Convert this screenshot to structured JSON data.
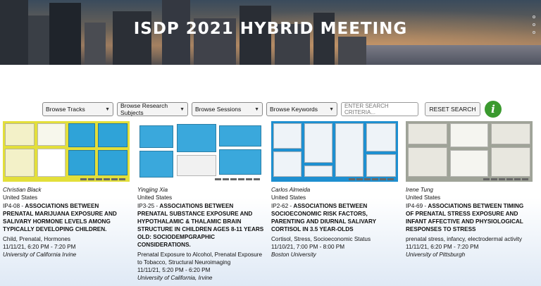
{
  "banner": {
    "title": "ISDP 2021 HYBRID MEETING"
  },
  "filters": {
    "tracks": "Browse Tracks",
    "subjects": "Browse Research Subjects",
    "sessions": "Browse Sessions",
    "keywords": "Browse Keywords",
    "search_placeholder": "ENTER SEARCH CRITERIA...",
    "reset_label": "RESET SEARCH",
    "info_glyph": "i"
  },
  "colors": {
    "info": "#3b9a2f",
    "yellow_poster": "#e3df3a",
    "blue_poster": "#2fa3d8"
  },
  "cards": [
    {
      "author": "Christian Black",
      "country": "United States",
      "code": "IP4-08",
      "title": "ASSOCIATIONS BETWEEN PRENATAL MARIJUANA EXPOSURE AND SALIVARY HORMONE LEVELS AMONG TYPICALLY DEVELOPING CHILDREN.",
      "keywords": "Child, Prenatal, Hormones",
      "time": "11/11/21, 6:20 PM - 7:20 PM",
      "institution": "University of California Irvine"
    },
    {
      "author": "Yingjing Xia",
      "country": "United States",
      "code": "IP3-25",
      "title": "ASSOCIATIONS BETWEEN PRENATAL SUBSTANCE EXPOSURE AND HYPOTHALAMIC & THALAMIC BRAIN STRUCTURE IN CHILDREN AGES 8-11 YEARS OLD: SOCIODEMPGRAPHIC CONSIDERATIONS.",
      "keywords": "Prenatal Exposure to Alcohol, Prenatal Exposure to Tobacco, Structural Neuroimaging",
      "time": "11/11/21, 5:20 PM - 6:20 PM",
      "institution": "University of California, Irvine"
    },
    {
      "author": "Carlos Almeida",
      "country": "United States",
      "code": "IP2-62",
      "title": "ASSOCIATIONS BETWEEN SOCIOECONOMIC RISK FACTORS, PARENTING AND DIURNAL SALIVARY CORTISOL IN 3.5 YEAR-OLDS",
      "keywords": "Cortisol, Stress, Socioeconomic Status",
      "time": "11/10/21, 7:00 PM - 8:00 PM",
      "institution": "Boston University"
    },
    {
      "author": "Irene Tung",
      "country": "United States",
      "code": "IP4-69",
      "title": "ASSOCIATIONS BETWEEN TIMING OF PRENATAL STRESS EXPOSURE AND INFANT AFFECTIVE AND PHYSIOLOGICAL RESPONSES TO STRESS",
      "keywords": "prenatal stress, infancy, electrodermal activity",
      "time": "11/11/21, 6:20 PM - 7:20 PM",
      "institution": "University of Pittsburgh"
    }
  ]
}
